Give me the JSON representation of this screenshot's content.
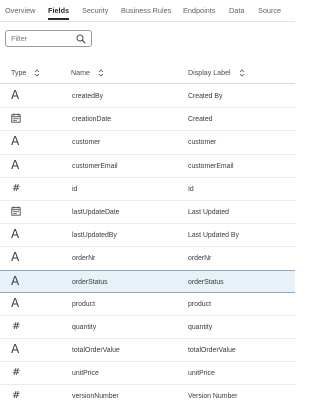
{
  "tabs": [
    {
      "label": "Overview",
      "active": false
    },
    {
      "label": "Fields",
      "active": true
    },
    {
      "label": "Security",
      "active": false
    },
    {
      "label": "Business Rules",
      "active": false
    },
    {
      "label": "Endpoints",
      "active": false
    },
    {
      "label": "Data",
      "active": false
    },
    {
      "label": "Source",
      "active": false
    }
  ],
  "filter": {
    "placeholder": "Filter",
    "icon": "search-icon"
  },
  "table": {
    "headers": {
      "type": "Type",
      "name": "Name",
      "display_label": "Display Label"
    },
    "selected_index": 9,
    "rows": [
      {
        "type": "text",
        "name": "createdBy",
        "label": "Created By"
      },
      {
        "type": "date",
        "name": "creationDate",
        "label": "Created"
      },
      {
        "type": "text",
        "name": "customer",
        "label": "customer"
      },
      {
        "type": "text",
        "name": "customerEmail",
        "label": "customerEmail"
      },
      {
        "type": "number",
        "name": "id",
        "label": "Id"
      },
      {
        "type": "date",
        "name": "lastUpdateDate",
        "label": "Last Updated"
      },
      {
        "type": "text",
        "name": "lastUpdatedBy",
        "label": "Last Updated By"
      },
      {
        "type": "text",
        "name": "orderNr",
        "label": "orderNr"
      },
      {
        "type": "text",
        "name": "orderStatus",
        "label": "orderStatus"
      },
      {
        "type": "text",
        "name": "product",
        "label": "product"
      },
      {
        "type": "number",
        "name": "quantity",
        "label": "quantity"
      },
      {
        "type": "text",
        "name": "totalOrderValue",
        "label": "totalOrderValue"
      },
      {
        "type": "number",
        "name": "unitPrice",
        "label": "unitPrice"
      },
      {
        "type": "number",
        "name": "versionNumber",
        "label": "Version Number"
      }
    ]
  },
  "colors": {
    "selected_row_bg": "#e7f1f8",
    "selected_row_border": "#8aaccb",
    "active_tab": "#2b2b2b"
  }
}
